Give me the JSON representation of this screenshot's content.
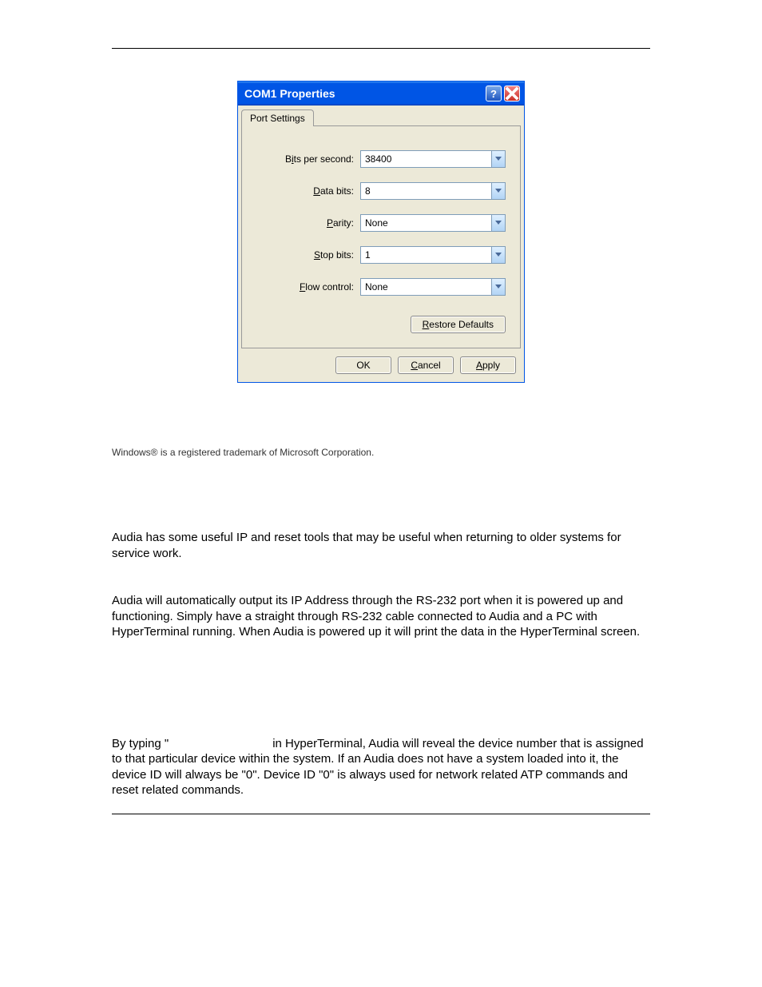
{
  "dialog": {
    "title": "COM1 Properties",
    "tab_label": "Port Settings",
    "fields": {
      "bits_per_second": {
        "label_pre": "B",
        "label_u": "i",
        "label_post": "ts per second:",
        "value": "38400"
      },
      "data_bits": {
        "label_pre": "",
        "label_u": "D",
        "label_post": "ata bits:",
        "value": "8"
      },
      "parity": {
        "label_pre": "",
        "label_u": "P",
        "label_post": "arity:",
        "value": "None"
      },
      "stop_bits": {
        "label_pre": "",
        "label_u": "S",
        "label_post": "top bits:",
        "value": "1"
      },
      "flow_control": {
        "label_pre": "",
        "label_u": "F",
        "label_post": "low control:",
        "value": "None"
      }
    },
    "buttons": {
      "restore_pre": "",
      "restore_u": "R",
      "restore_post": "estore Defaults",
      "ok": "OK",
      "cancel_pre": "",
      "cancel_u": "C",
      "cancel_post": "ancel",
      "apply_pre": "",
      "apply_u": "A",
      "apply_post": "pply"
    }
  },
  "text": {
    "trademark": "Windows® is a registered trademark of Microsoft Corporation.",
    "para1": "Audia has some useful IP and reset tools that may be useful when returning to older systems for service work.",
    "para2": "Audia will automatically output its IP Address through the RS-232 port when it is powered up and functioning. Simply have a straight through RS-232 cable connected to Audia and a PC with HyperTerminal running. When Audia is powered up it will print the data in the HyperTerminal screen.",
    "para3_a": "By typing \"",
    "para3_b": "in HyperTerminal, Audia will reveal the device number that is assigned to that particular device within the system. If an Audia does not have a system loaded into it, the device ID will always be \"0\". Device ID \"0\" is always used for network related ATP commands and reset related commands."
  }
}
